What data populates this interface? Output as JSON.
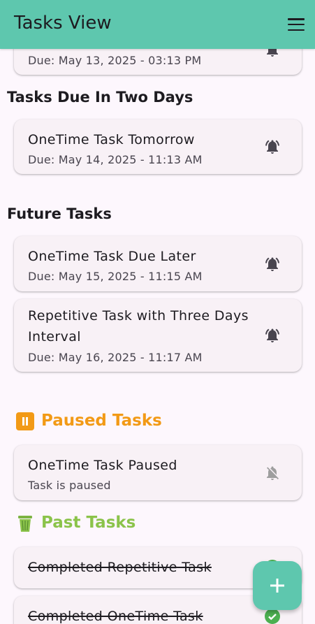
{
  "appbar": {
    "title": "Tasks View",
    "menu_icon": "menu-icon"
  },
  "top_partial": {
    "due": "Due: May 13, 2025 - 03:13 PM"
  },
  "sections": {
    "two_days": "Tasks Due In Two Days",
    "future": "Future Tasks",
    "paused": "Paused Tasks",
    "past": "Past Tasks"
  },
  "tasks": {
    "tomorrow": {
      "name": "OneTime Task Tomorrow",
      "due": "Due: May 14, 2025 - 11:13 AM"
    },
    "later": {
      "name": "OneTime Task Due Later",
      "due": "Due: May 15, 2025 - 11:15 AM"
    },
    "repetitive": {
      "name_line1": "Repetitive Task with Three Days",
      "name_line2": "Interval",
      "due": "Due: May 16, 2025 - 11:17 AM"
    },
    "paused": {
      "name": "OneTime Task Paused",
      "status": "Task is paused"
    },
    "completed_repetitive": {
      "name": "Completed Repetitive Task"
    },
    "completed_onetime": {
      "name": "Completed OneTime Task"
    }
  },
  "colors": {
    "appbar": "#5ec7ae",
    "paused": "#f29a16",
    "past": "#8bc34a",
    "check": "#4caf50"
  },
  "fab": {
    "icon": "plus-icon"
  }
}
